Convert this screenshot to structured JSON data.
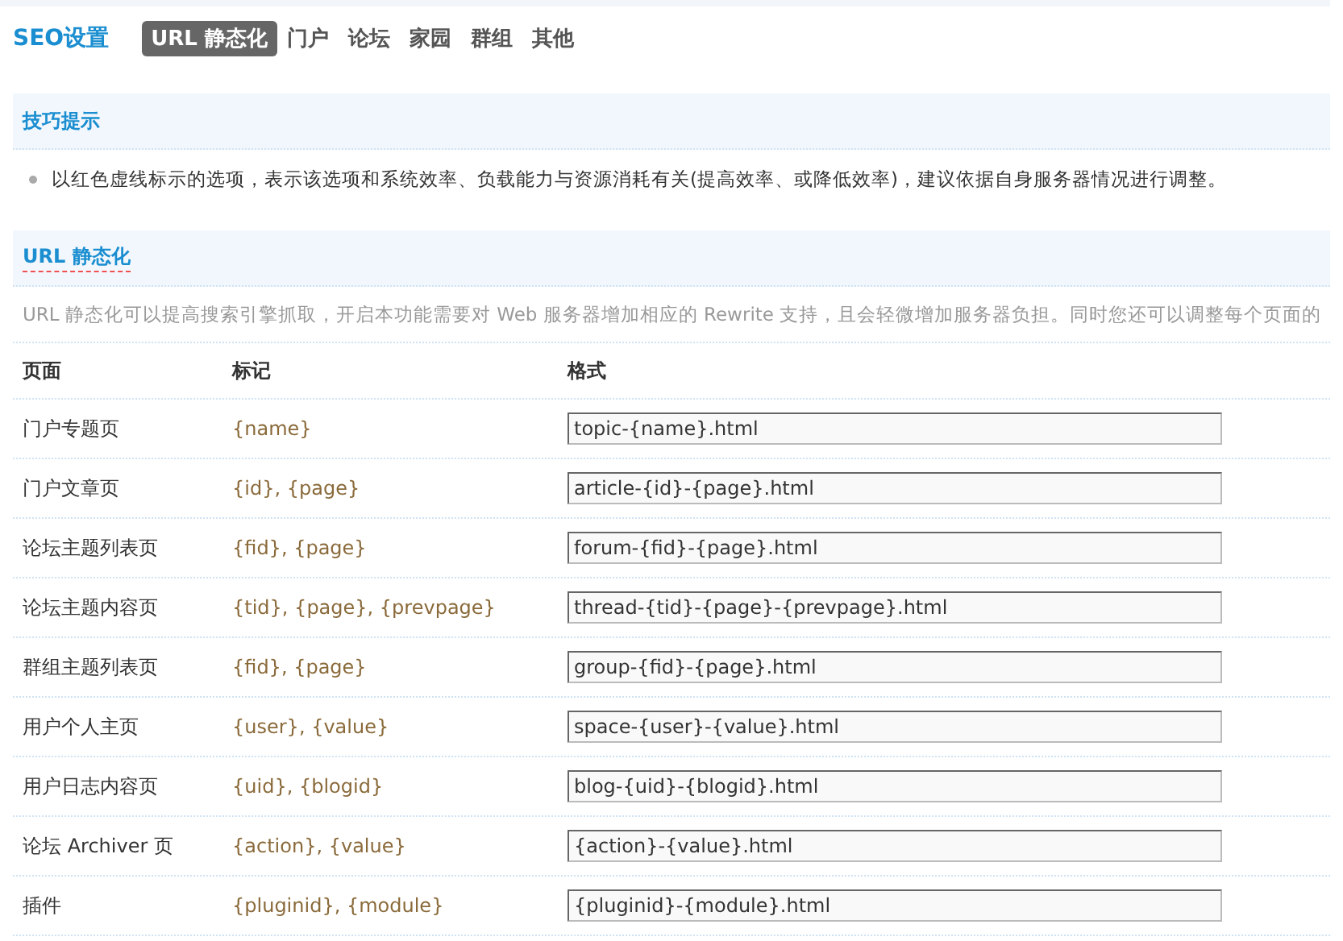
{
  "header": {
    "title": "SEO设置"
  },
  "tabs": [
    {
      "label": "URL 静态化",
      "selected": true
    },
    {
      "label": "门户",
      "selected": false
    },
    {
      "label": "论坛",
      "selected": false
    },
    {
      "label": "家园",
      "selected": false
    },
    {
      "label": "群组",
      "selected": false
    },
    {
      "label": "其他",
      "selected": false
    }
  ],
  "tips": {
    "title": "技巧提示",
    "items": [
      "以红色虚线标示的选项，表示该选项和系统效率、负载能力与资源消耗有关(提高效率、或降低效率)，建议依据自身服务器情况进行调整。"
    ]
  },
  "section": {
    "title": "URL 静态化",
    "description": "URL 静态化可以提高搜索引擎抓取，开启本功能需要对 Web 服务器增加相应的 Rewrite 支持，且会轻微增加服务器负担。同时您还可以调整每个页面的"
  },
  "table": {
    "columns": [
      "页面",
      "标记",
      "格式"
    ],
    "rows": [
      {
        "page": "门户专题页",
        "marks": "{name}",
        "format": "topic-{name}.html"
      },
      {
        "page": "门户文章页",
        "marks": "{id}, {page}",
        "format": "article-{id}-{page}.html"
      },
      {
        "page": "论坛主题列表页",
        "marks": "{fid}, {page}",
        "format": "forum-{fid}-{page}.html"
      },
      {
        "page": "论坛主题内容页",
        "marks": "{tid}, {page}, {prevpage}",
        "format": "thread-{tid}-{page}-{prevpage}.html"
      },
      {
        "page": "群组主题列表页",
        "marks": "{fid}, {page}",
        "format": "group-{fid}-{page}.html"
      },
      {
        "page": "用户个人主页",
        "marks": "{user}, {value}",
        "format": "space-{user}-{value}.html"
      },
      {
        "page": "用户日志内容页",
        "marks": "{uid}, {blogid}",
        "format": "blog-{uid}-{blogid}.html"
      },
      {
        "page": "论坛 Archiver 页",
        "marks": "{action}, {value}",
        "format": "{action}-{value}.html"
      },
      {
        "page": "插件",
        "marks": "{pluginid}, {module}",
        "format": "{pluginid}-{module}.html"
      }
    ]
  }
}
